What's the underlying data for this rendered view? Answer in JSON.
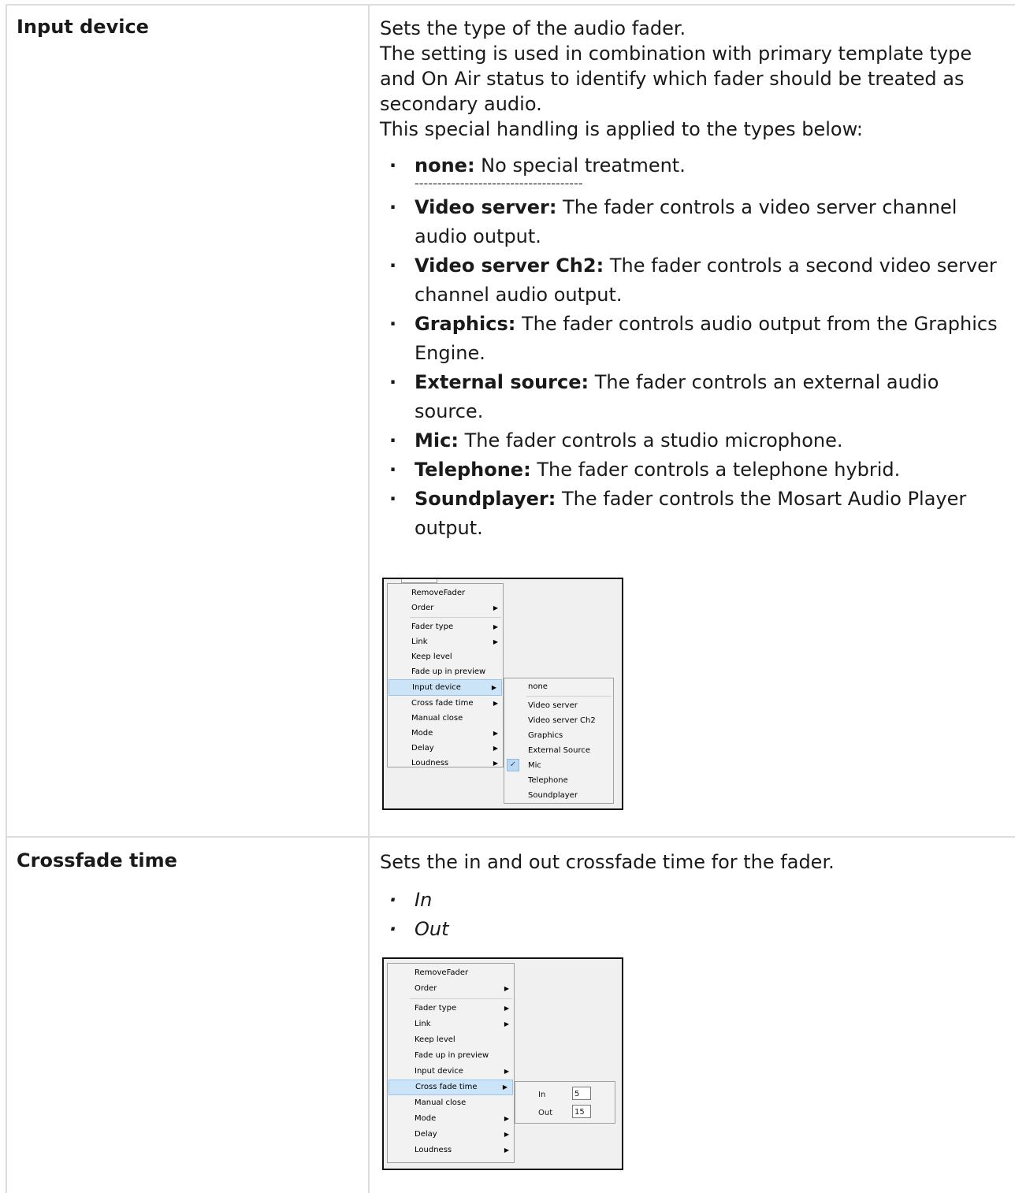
{
  "rows": [
    {
      "label": "Input device",
      "intro": [
        "Sets the type of the audio fader.",
        "The setting is used in combination with primary template type and On Air status to identify which fader should be treated as secondary audio.",
        "This special handling is applied to the types below:"
      ],
      "items": [
        {
          "term": "none:",
          "text": " No special treatment."
        },
        {
          "term": "Video server:",
          "text": " The fader controls a video server channel audio output."
        },
        {
          "term": "Video server Ch2:",
          "text": " The fader controls a second video server channel audio output."
        },
        {
          "term": "Graphics:",
          "text": " The fader controls audio output from the Graphics Engine."
        },
        {
          "term": "External source:",
          "text": " The fader controls an external audio source."
        },
        {
          "term": "Mic:",
          "text": " The fader controls a studio microphone."
        },
        {
          "term": "Telephone:",
          "text": " The fader controls a telephone hybrid."
        },
        {
          "term": "Soundplayer:",
          "text": " The fader controls the Mosart Audio Player output."
        }
      ],
      "separator": "-------------------------------------",
      "menu": [
        "RemoveFader",
        "Order",
        "Fader type",
        "Link",
        "Keep level",
        "Fade up in preview",
        "Input device",
        "Cross fade time",
        "Manual close",
        "Mode",
        "Delay",
        "Loudness"
      ],
      "submenu": [
        "none",
        "Video server",
        "Video server Ch2",
        "Graphics",
        "External Source",
        "Mic",
        "Telephone",
        "Soundplayer"
      ]
    },
    {
      "label": "Crossfade time",
      "intro": [
        "Sets the in and out crossfade time for the fader."
      ],
      "items": [
        "In",
        "Out"
      ],
      "menu": [
        "RemoveFader",
        "Order",
        "Fader type",
        "Link",
        "Keep level",
        "Fade up in preview",
        "Input device",
        "Cross fade time",
        "Manual close",
        "Mode",
        "Delay",
        "Loudness"
      ],
      "fields": [
        {
          "label": "In",
          "value": "5"
        },
        {
          "label": "Out",
          "value": "15"
        }
      ]
    }
  ]
}
